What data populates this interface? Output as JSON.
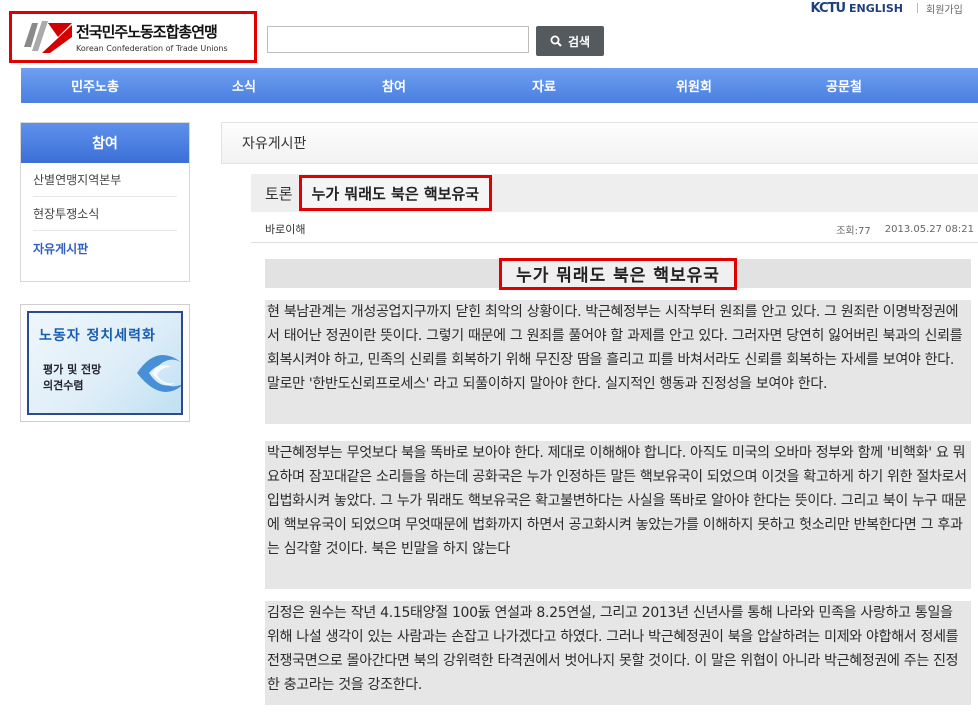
{
  "utility": {
    "ktu_logo": "KCTU",
    "english": "ENGLISH",
    "join": "회원가입"
  },
  "logo": {
    "korean": "전국민주노동조합총연맹",
    "english": "Korean Confederation of Trade Unions"
  },
  "search": {
    "placeholder": "",
    "button_label": "검색"
  },
  "nav": [
    "민주노총",
    "소식",
    "참여",
    "자료",
    "위원회",
    "공문철"
  ],
  "sidebar": {
    "title": "참여",
    "items": [
      {
        "label": "산별연맹지역본부",
        "active": false
      },
      {
        "label": "현장투쟁소식",
        "active": false
      },
      {
        "label": "자유게시판",
        "active": true
      }
    ]
  },
  "banner": {
    "title": "노동자 정치세력화",
    "line1": "평가 및 전망",
    "line2": "의견수렴"
  },
  "board": {
    "name": "자유게시판"
  },
  "post": {
    "category": "토론",
    "title": "누가 뭐래도 북은 핵보유국",
    "author": "바로이해",
    "views": "조회:77",
    "date": "2013.05.27 08:21",
    "article_title": "누가 뭐래도 북은 핵보유국",
    "paragraphs": [
      "현 북남관계는 개성공업지구까지 닫힌 최악의 상황이다. 박근혜정부는 시작부터 원죄를 안고 있다. 그 원죄란 이명박정권에서 태어난 정권이란 뜻이다. 그렇기 때문에 그 원죄를 풀어야 할 과제를 안고 있다. 그러자면 당연히 잃어버린 북과의 신뢰를 회복시켜야 하고, 민족의 신뢰를 회복하기 위해 무진장 땀을 흘리고 피를 바쳐서라도 신뢰를 회복하는 자세를 보여야 한다. 말로만 '한반도신뢰프로세스' 라고 되풀이하지 말아야 한다. 실지적인 행동과 진정성을 보여야 한다.",
      "박근혜정부는 무엇보다 북을 똑바로 보아야 한다. 제대로 이해해야 합니다. 아직도 미국의 오바마 정부와 함께 '비핵화' 요 뭐요하며 잠꼬대같은 소리들을 하는데 공화국은 누가 인정하든 말든 핵보유국이 되었으며 이것을 확고하게 하기 위한 절차로서 입법화시켜 놓았다. 그 누가 뭐래도 핵보유국은 확고불변하다는 사실을 똑바로 알아야 한다는 뜻이다. 그리고 북이 누구 때문에 핵보유국이 되었으며 무엇때문에 법화까지 하면서 공고화시켜 놓았는가를 이해하지 못하고 헛소리만 반복한다면 그 후과는 심각할 것이다. 북은 빈말을 하지 않는다",
      "김정은 원수는 작년 4.15태양절 100돐 연설과 8.25연설, 그리고 2013년 신년사를 통해 나라와 민족을 사랑하고 통일을 위해 나설 생각이 있는 사람과는 손잡고 나가겠다고 하였다. 그러나 박근혜정권이 북을 압살하려는 미제와 야합해서 정세를 전쟁국면으로 몰아간다면 북의 강위력한 타격권에서 벗어나지 못할 것이다. 이 말은 위협이 아니라 박근혜정권에 주는 진정한 충고라는 것을 강조한다."
    ]
  }
}
